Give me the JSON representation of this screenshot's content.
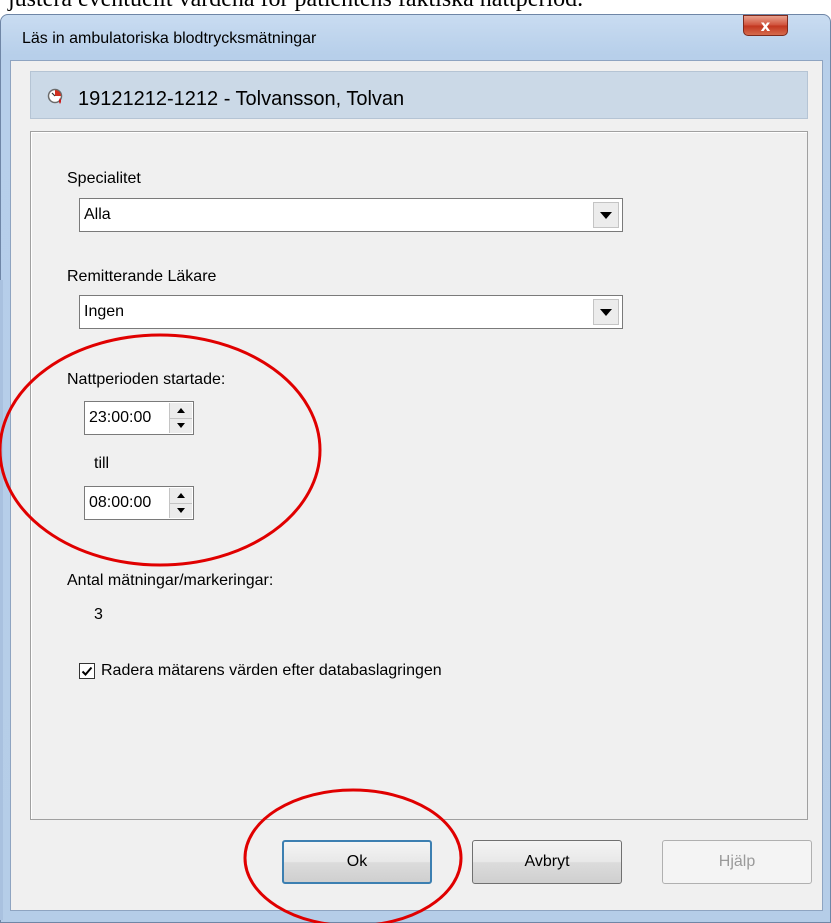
{
  "document_text": "justera eventuellt värdena för patientens faktiska nattperiod.",
  "window": {
    "title": "Läs in ambulatoriska blodtrycksmätningar",
    "close_glyph": "x"
  },
  "patient": {
    "header_text": "19121212-1212 - Tolvansson, Tolvan",
    "icon": "patient-record-icon"
  },
  "form": {
    "specialitet_label": "Specialitet",
    "specialitet_value": "Alla",
    "remitterande_label": "Remitterande Läkare",
    "remitterande_value": "Ingen",
    "nattperiod_label": "Nattperioden startade:",
    "start_time": "23:00:00",
    "till_label": "till",
    "end_time": "08:00:00",
    "antal_label": "Antal mätningar/markeringar:",
    "antal_value": "3",
    "delete_checkbox_label": "Radera mätarens värden efter databaslagringen",
    "delete_checked": true
  },
  "buttons": {
    "ok": "Ok",
    "cancel": "Avbryt",
    "help": "Hjälp"
  },
  "colors": {
    "annotation": "#e00000",
    "close_button": "#c2361f",
    "header_band": "#cbd9e7"
  }
}
